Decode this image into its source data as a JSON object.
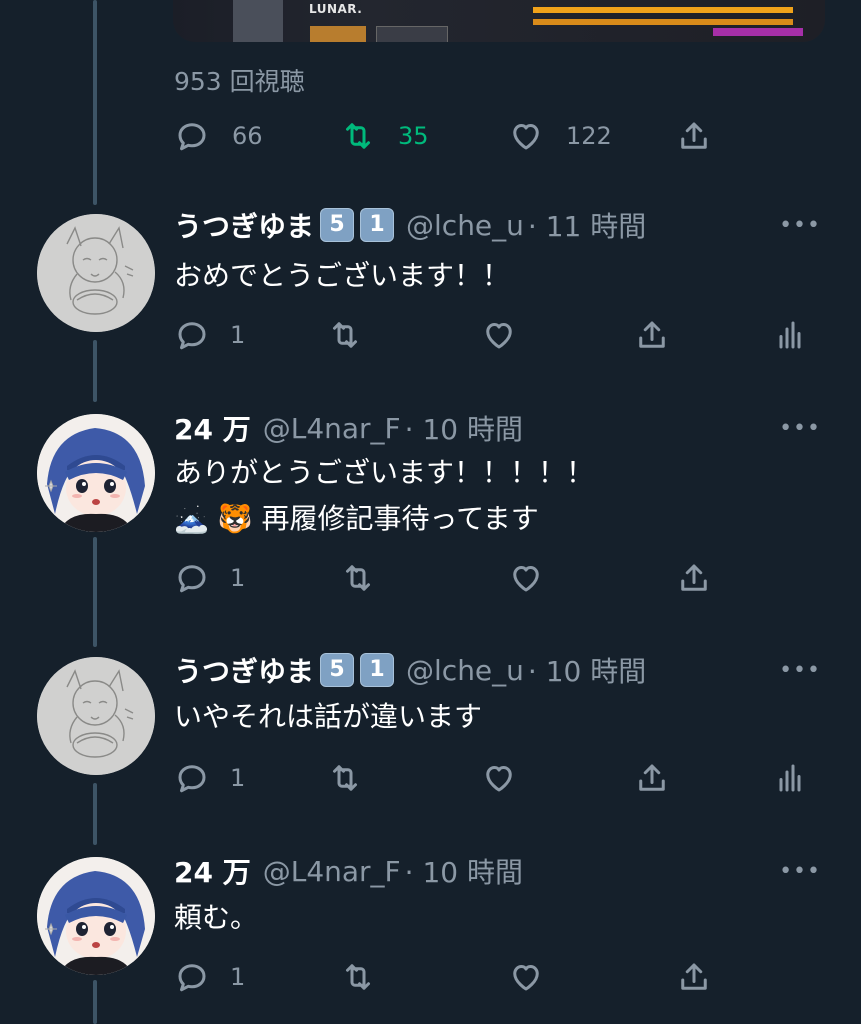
{
  "media": {
    "label": "LUNAR."
  },
  "stats": {
    "views": "953 回視聴"
  },
  "main_actions": {
    "reply_count": "66",
    "retweet_count": "35",
    "like_count": "122"
  },
  "tweets": [
    {
      "name": "うつぎゆま",
      "badges": [
        "5",
        "1"
      ],
      "handle": "@lche_u",
      "time": "· 11 時間",
      "lines": [
        "おめでとうございます！！"
      ],
      "reply_count": "1",
      "avatar": "sketch"
    },
    {
      "name": "24 万",
      "badges": [],
      "handle": "@L4nar_F",
      "time": "· 10 時間",
      "lines": [
        "ありがとうございます！！！！！",
        "🗻 🐯 再履修記事待ってます"
      ],
      "reply_count": "1",
      "avatar": "anime"
    },
    {
      "name": "うつぎゆま",
      "badges": [
        "5",
        "1"
      ],
      "handle": "@lche_u",
      "time": "· 10 時間",
      "lines": [
        "いやそれは話が違います"
      ],
      "reply_count": "1",
      "avatar": "sketch"
    },
    {
      "name": "24 万",
      "badges": [],
      "handle": "@L4nar_F",
      "time": "· 10 時間",
      "lines": [
        "頼む。"
      ],
      "reply_count": "1",
      "avatar": "anime"
    }
  ],
  "more_label": "•••",
  "colors": {
    "background": "#15202b",
    "muted": "#8b98a5",
    "retweet_active": "#00ba7c",
    "thread_line": "#3d5466"
  }
}
